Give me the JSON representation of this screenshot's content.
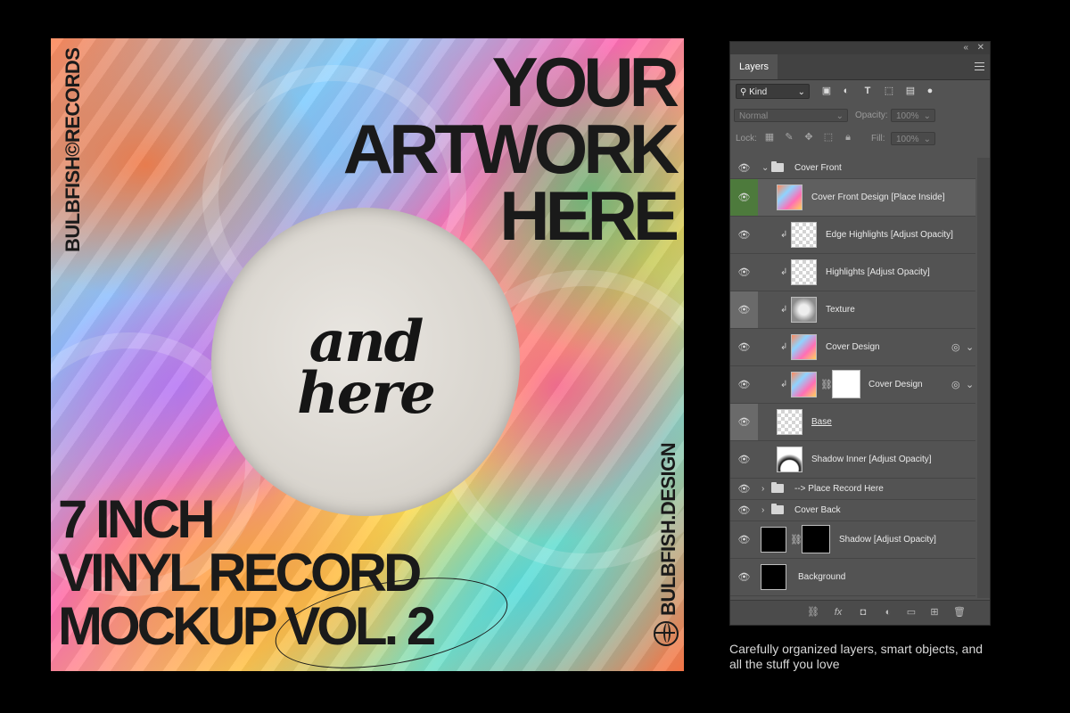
{
  "artwork": {
    "headline": [
      "YOUR",
      "ARTWORK",
      "HERE"
    ],
    "label_text": [
      "and",
      "here"
    ],
    "bottom_title": [
      "7 INCH",
      "VINYL RECORD",
      "MOCKUP VOL. 2"
    ],
    "left_vertical": "BULBFISH©RECORDS",
    "right_vertical": "BULBFISH.DESIGN"
  },
  "panel": {
    "tab": "Layers",
    "filter": {
      "kind": "Kind"
    },
    "blend_mode": "Normal",
    "opacity_label": "Opacity:",
    "opacity_value": "100%",
    "lock_label": "Lock:",
    "fill_label": "Fill:",
    "fill_value": "100%",
    "layers": [
      {
        "name": "Cover Front",
        "type": "group"
      },
      {
        "name": "Cover Front Design [Place Inside]"
      },
      {
        "name": "Edge Highlights [Adjust Opacity]"
      },
      {
        "name": "Highlights [Adjust Opacity]"
      },
      {
        "name": "Texture"
      },
      {
        "name": "Cover Design"
      },
      {
        "name": "Cover Design"
      },
      {
        "name": "Base"
      },
      {
        "name": "Shadow Inner [Adjust Opacity]"
      },
      {
        "name": "--> Place Record Here",
        "type": "group"
      },
      {
        "name": "Cover Back",
        "type": "group"
      },
      {
        "name": "Shadow [Adjust Opacity]"
      },
      {
        "name": "Background"
      }
    ]
  },
  "caption": "Carefully organized layers, smart objects, and all the stuff you love",
  "colors": {
    "selected_eye": "#4d7a3c",
    "panel_bg": "#535353"
  }
}
